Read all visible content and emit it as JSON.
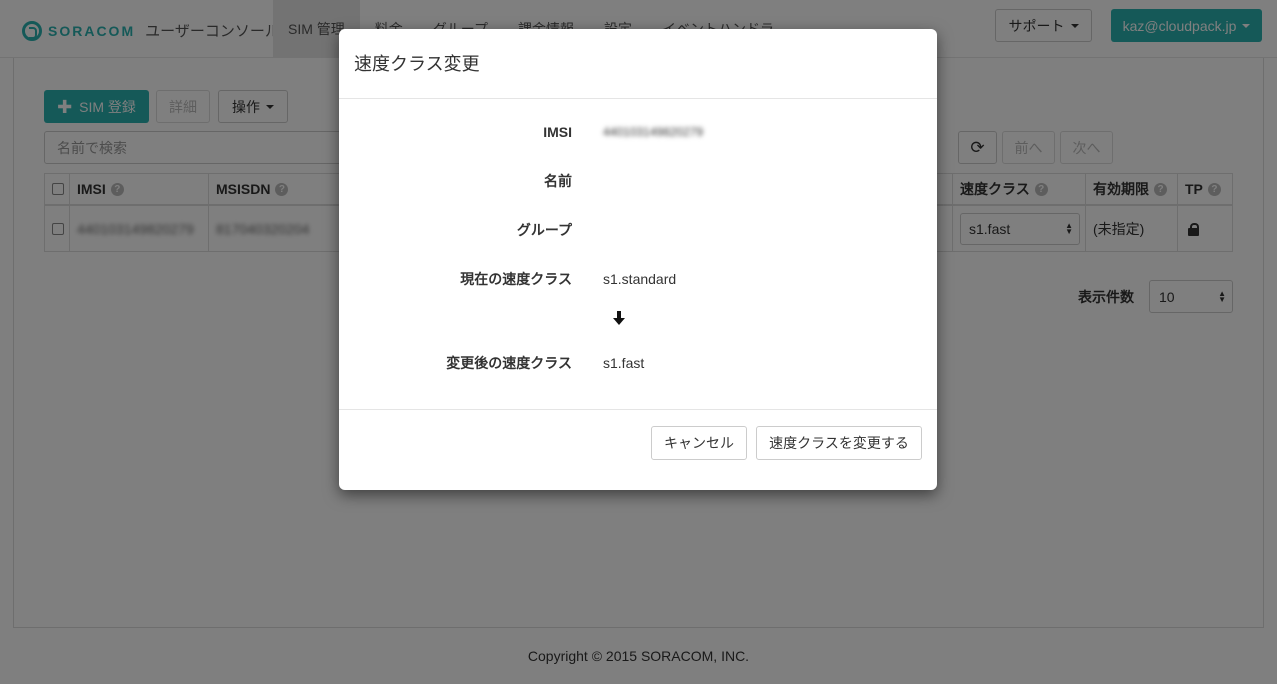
{
  "header": {
    "brand": "SORACOM",
    "app_title": "ユーザーコンソール",
    "nav": [
      "SIM 管理",
      "料金",
      "グループ",
      "課金情報",
      "設定",
      "イベントハンドラ"
    ],
    "support_label": "サポート",
    "user_label": "kaz@cloudpack.jp"
  },
  "toolbar": {
    "register_label": "SIM 登録",
    "detail_label": "詳細",
    "operations_label": "操作",
    "search_placeholder": "名前で検索",
    "prev_label": "前へ",
    "next_label": "次へ"
  },
  "table": {
    "columns": {
      "imsi": "IMSI",
      "msisdn": "MSISDN",
      "speed_class": "速度クラス",
      "expiry": "有効期限",
      "tp": "TP"
    },
    "rows": [
      {
        "imsi": "440103149820279",
        "msisdn": "817040320204",
        "speed_class": "s1.fast",
        "expiry": "(未指定)"
      }
    ]
  },
  "pagination": {
    "per_page_label": "表示件数",
    "per_page_value": "10"
  },
  "footer": {
    "copyright": "Copyright © 2015 SORACOM, INC."
  },
  "modal": {
    "title": "速度クラス変更",
    "fields": {
      "imsi_label": "IMSI",
      "imsi_value": "440103149820279",
      "name_label": "名前",
      "name_value": "",
      "group_label": "グループ",
      "group_value": "",
      "current_label": "現在の速度クラス",
      "current_value": "s1.standard",
      "new_label": "変更後の速度クラス",
      "new_value": "s1.fast"
    },
    "cancel_label": "キャンセル",
    "submit_label": "速度クラスを変更する"
  },
  "colors": {
    "accent": "#2bb2b0",
    "backdrop": "rgba(0,0,0,0.5)"
  }
}
